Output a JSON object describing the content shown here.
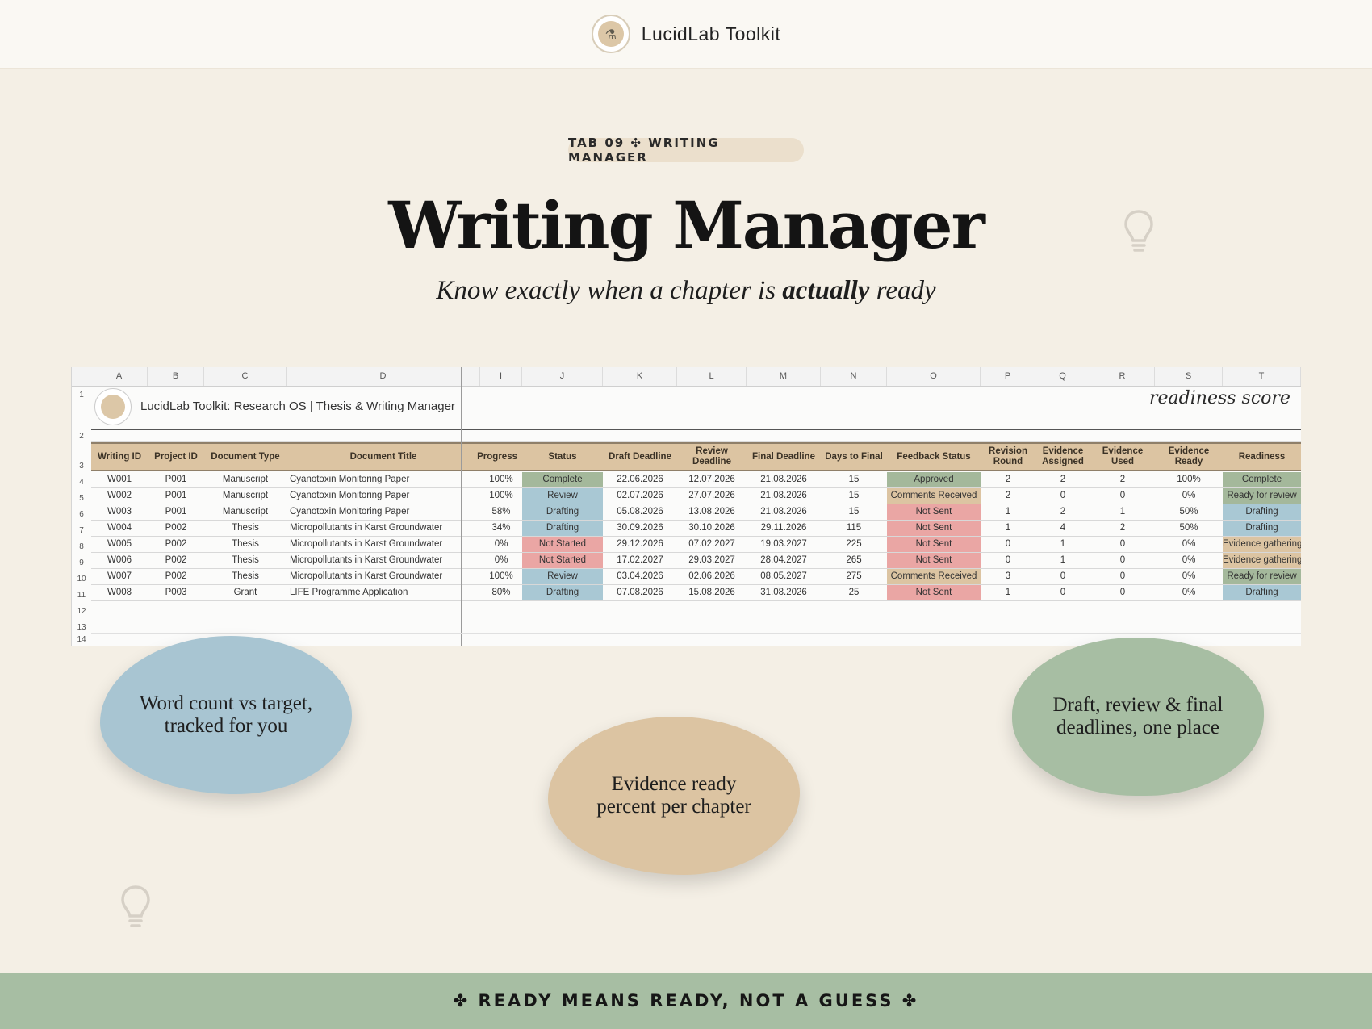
{
  "brand": {
    "name": "LucidLab Toolkit",
    "logo_icon": "microscope-icon"
  },
  "tab_pill": "TAB 09 ✣ WRITING MANAGER",
  "title": "Writing Manager",
  "subtitle": {
    "before": "Know exactly when a chapter is ",
    "emph": "actually",
    "after": " ready"
  },
  "sheet": {
    "col_letters": [
      "A",
      "B",
      "C",
      "D",
      "I",
      "J",
      "K",
      "L",
      "M",
      "N",
      "O",
      "P",
      "Q",
      "R",
      "S",
      "T"
    ],
    "row_numbers": [
      "1",
      "2",
      "3",
      "4",
      "5",
      "6",
      "7",
      "8",
      "9",
      "10",
      "11",
      "12",
      "13",
      "14"
    ],
    "banner": "LucidLab Toolkit: Research OS  |  Thesis & Writing Manager",
    "readiness_label": "readiness score",
    "headers": [
      "Writing ID",
      "Project ID",
      "Document Type",
      "Document Title",
      "Progress",
      "Status",
      "Draft Deadline",
      "Review Deadline",
      "Final Deadline",
      "Days to Final",
      "Feedback Status",
      "Revision Round",
      "Evidence Assigned",
      "Evidence Used",
      "Evidence Ready",
      "Readiness"
    ],
    "rows": [
      [
        "W001",
        "P001",
        "Manuscript",
        "Cyanotoxin Monitoring Paper",
        "100%",
        "Complete",
        "22.06.2026",
        "12.07.2026",
        "21.08.2026",
        "15",
        "Approved",
        "2",
        "2",
        "2",
        "100%",
        "Complete"
      ],
      [
        "W002",
        "P001",
        "Manuscript",
        "Cyanotoxin Monitoring Paper",
        "100%",
        "Review",
        "02.07.2026",
        "27.07.2026",
        "21.08.2026",
        "15",
        "Comments Received",
        "2",
        "0",
        "0",
        "0%",
        "Ready for review"
      ],
      [
        "W003",
        "P001",
        "Manuscript",
        "Cyanotoxin Monitoring Paper",
        "58%",
        "Drafting",
        "05.08.2026",
        "13.08.2026",
        "21.08.2026",
        "15",
        "Not Sent",
        "1",
        "2",
        "1",
        "50%",
        "Drafting"
      ],
      [
        "W004",
        "P002",
        "Thesis",
        "Micropollutants in Karst Groundwater",
        "34%",
        "Drafting",
        "30.09.2026",
        "30.10.2026",
        "29.11.2026",
        "115",
        "Not Sent",
        "1",
        "4",
        "2",
        "50%",
        "Drafting"
      ],
      [
        "W005",
        "P002",
        "Thesis",
        "Micropollutants in Karst Groundwater",
        "0%",
        "Not Started",
        "29.12.2026",
        "07.02.2027",
        "19.03.2027",
        "225",
        "Not Sent",
        "0",
        "1",
        "0",
        "0%",
        "Evidence gathering"
      ],
      [
        "W006",
        "P002",
        "Thesis",
        "Micropollutants in Karst Groundwater",
        "0%",
        "Not Started",
        "17.02.2027",
        "29.03.2027",
        "28.04.2027",
        "265",
        "Not Sent",
        "0",
        "1",
        "0",
        "0%",
        "Evidence gathering"
      ],
      [
        "W007",
        "P002",
        "Thesis",
        "Micropollutants in Karst Groundwater",
        "100%",
        "Review",
        "03.04.2026",
        "02.06.2026",
        "08.05.2027",
        "275",
        "Comments Received",
        "3",
        "0",
        "0",
        "0%",
        "Ready for review"
      ],
      [
        "W008",
        "P003",
        "Grant",
        "LIFE Programme Application",
        "80%",
        "Drafting",
        "07.08.2026",
        "15.08.2026",
        "31.08.2026",
        "25",
        "Not Sent",
        "1",
        "0",
        "0",
        "0%",
        "Drafting"
      ]
    ],
    "status_colors": {
      "Complete": "#a4b89b",
      "Review": "#a9c8d4",
      "Drafting": "#a9c8d4",
      "Not Started": "#eaa6a4"
    },
    "feedback_colors": {
      "Approved": "#a4b89b",
      "Comments Received": "#dcc4a2",
      "Not Sent": "#eaa6a4"
    },
    "readiness_colors": {
      "Complete": "#a4b89b",
      "Ready for review": "#a4b89b",
      "Drafting": "#a9c8d4",
      "Evidence gathering": "#dcc4a2"
    }
  },
  "blobs": {
    "left": "Word count vs target, tracked for you",
    "middle": "Evidence ready percent per chapter",
    "right": "Draft, review & final deadlines, one place"
  },
  "blob_colors": {
    "left": "#a8c5d2",
    "middle": "#dcc4a2",
    "right": "#a7bea3"
  },
  "footer": "✤ READY MEANS READY, NOT A GUESS ✤",
  "decor_icons": [
    "lightbulb-icon",
    "lightbulb-icon"
  ]
}
